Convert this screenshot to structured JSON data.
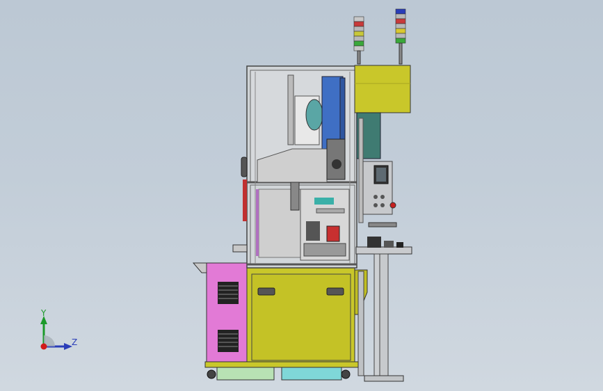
{
  "triad": {
    "y_label": "Y",
    "z_label": "Z",
    "colors": {
      "y_axis": "#1c9a2a",
      "z_axis": "#2a3db8",
      "origin": "#d11a1a"
    }
  },
  "colors": {
    "background_top": "#bcc8d4",
    "background_bottom": "#d0d8e0",
    "frame": "#c8ccd0",
    "olive_cabinet": "#c9c72a",
    "pink_cabinet": "#e27ad6",
    "blue_part": "#3f6fc4",
    "teal_guard": "#3f7b72",
    "control_panel": "#c7c9cc",
    "base_green": "#b8e2b4",
    "base_cyan": "#7fd7d8"
  },
  "signal_tower_left": [
    "#c8c8c8",
    "#c83a3a",
    "#b8b8b8",
    "#c8c83a",
    "#b8b8b8",
    "#3aa83a",
    "#c8c8c8"
  ],
  "signal_tower_right": [
    "#2a3db8",
    "#b8b8b8",
    "#c83a3a",
    "#b8b8b8",
    "#d8c830",
    "#b8b8b8",
    "#3aa83a"
  ]
}
